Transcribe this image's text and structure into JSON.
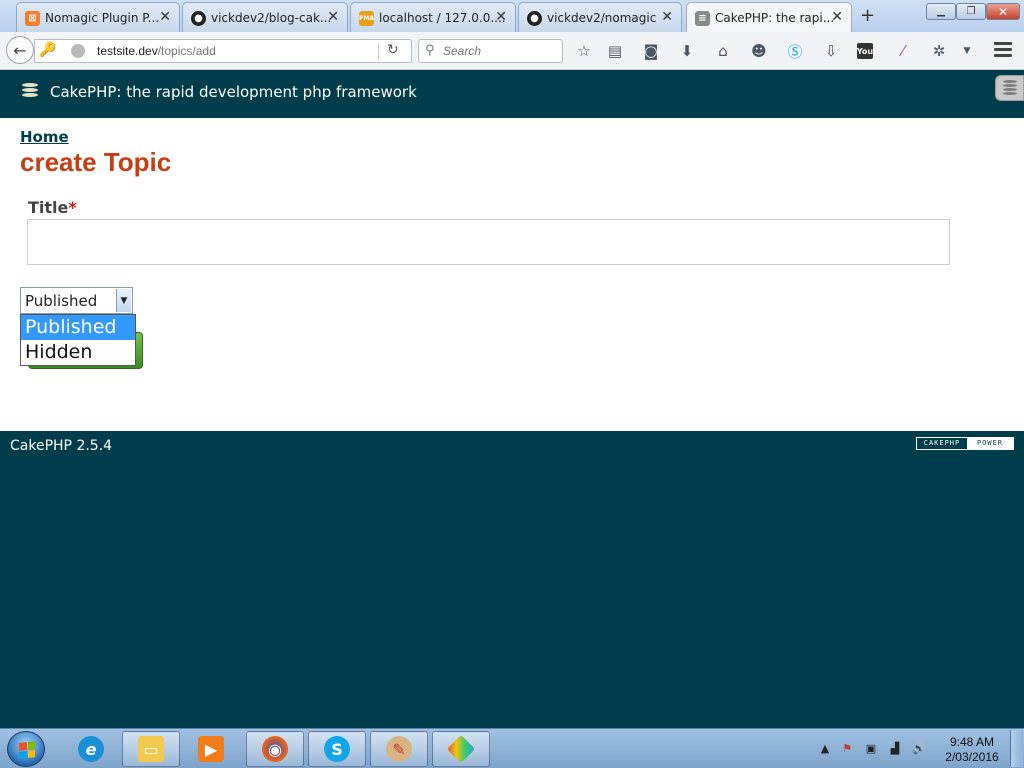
{
  "browser": {
    "tabs": [
      {
        "title": "Nomagic Plugin P...",
        "favicon": "xampp-icon",
        "color": "#f57d2b",
        "glyph": "⊠"
      },
      {
        "title": "vickdev2/blog-cak...",
        "favicon": "github-icon",
        "color": "#222222",
        "glyph": "●"
      },
      {
        "title": "localhost / 127.0.0....",
        "favicon": "phpmyadmin-icon",
        "color": "#e2a21c",
        "glyph": "PMA"
      },
      {
        "title": "vickdev2/nomagic",
        "favicon": "github-icon",
        "color": "#222222",
        "glyph": "●"
      },
      {
        "title": "CakePHP: the rapi...",
        "favicon": "cakephp-icon",
        "color": "#7d7d7d",
        "glyph": "≡",
        "active": true
      }
    ],
    "new_tab": "+",
    "url": {
      "host": "testsite.dev",
      "path": "/topics/add"
    },
    "search_placeholder": "Search"
  },
  "page": {
    "site_title": "CakePHP: the rapid development php framework",
    "breadcrumb": "Home",
    "heading": "create Topic",
    "form": {
      "title_label": "Title",
      "required_mark": "*",
      "title_value": "",
      "status_selected": "Published",
      "status_options": [
        "Published",
        "Hidden"
      ]
    },
    "footer_version": "CakePHP 2.5.4",
    "power_badge": {
      "left": "CAKEPHP",
      "right": "POWER"
    }
  },
  "taskbar": {
    "clock_time": "9:48 AM",
    "clock_date": "2/03/2016"
  },
  "colors": {
    "cake_header": "#003d4c",
    "heading_red": "#c73e14",
    "dropdown_highlight": "#3399ff",
    "submit_green": "#3b8a20"
  }
}
